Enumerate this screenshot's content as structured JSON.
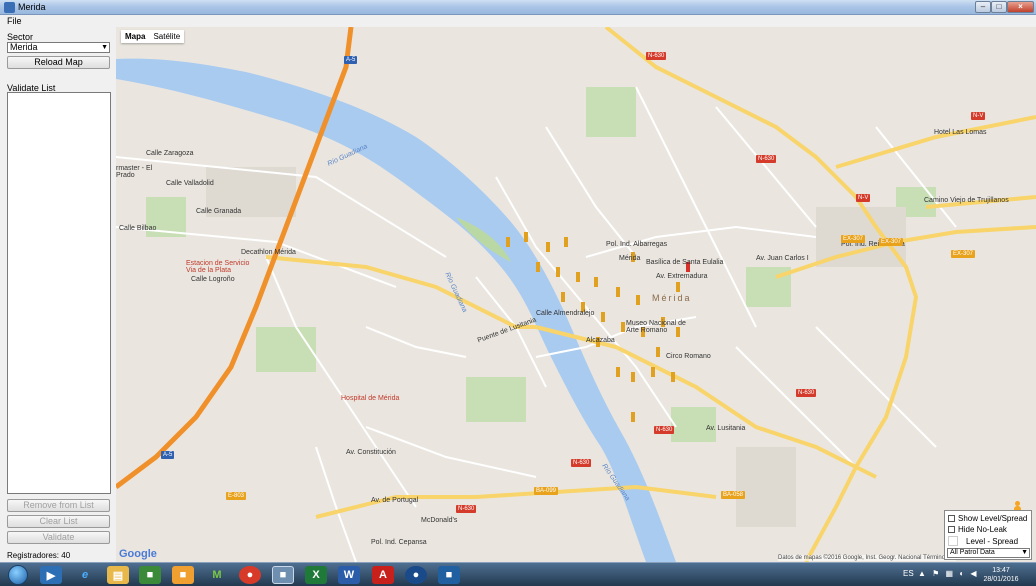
{
  "window": {
    "title": "Merida"
  },
  "menu": {
    "file": "File"
  },
  "left_panel": {
    "sector_label": "Sector",
    "sector_value": "Merida",
    "reload_button": "Reload Map",
    "validate_list_label": "Validate List",
    "remove_button": "Remove from List",
    "clear_button": "Clear List",
    "validate_button": "Validate",
    "registradores": "Registradores: 40"
  },
  "map": {
    "type_mapa": "Mapa",
    "type_satelite": "Satélite",
    "google_logo": "Google",
    "copyright": "Datos de mapas ©2016 Google, Inst. Geogr. Nacional   Términos de",
    "labels": {
      "rio_guadiana_1": "Río Guadiana",
      "rio_guadiana_2": "Río Guadiana",
      "rio_guadiana_3": "Río Guadiana",
      "merida": "Mérida",
      "merida_station": "Mérida",
      "hospital": "Hospital de Mérida",
      "decathlon": "Decathlon Mérida",
      "estacion": "Estacion de Servicio Via de la Plata",
      "poligono_albarregas": "Pol. Ind. Albarregas",
      "poligono_reina": "Pol. Ind. Reina Sofia",
      "hotel": "Hotel Las Lomas",
      "mcdonalds": "McDonald's",
      "cepansa": "Pol. Ind. Cepansa",
      "museo": "Museo Nacional de Arte Romano",
      "alcazaba": "Alcazaba",
      "circo": "Circo Romano",
      "basilica": "Basílica de Santa Eulalia",
      "puente": "Puente de Lusitania",
      "calle_zaragoza": "Calle Zaragoza",
      "calle_valladolid": "Calle Valladolid",
      "calle_granada": "Calle Granada",
      "calle_bilbao": "Calle Bilbao",
      "calle_logrono": "Calle Logroño",
      "av_extremadura": "Av. Extremadura",
      "av_portugal": "Av. de Portugal",
      "camino_trujillanos": "Camino Viejo de Trujillanos",
      "calle_almendralejo": "Calle Almendralejo",
      "av_constitucion": "Av. Constitución",
      "av_lusitania": "Av. Lusitania",
      "av_juan_carlos": "Av. Juan Carlos I",
      "ermasto": "rmaster - El Prado"
    },
    "road_badges": [
      "A-5",
      "N-630",
      "EX-307",
      "EX-307",
      "N-V",
      "BA-099",
      "N-630",
      "A-5",
      "E-803",
      "N-630",
      "EX-307",
      "N-630",
      "N-630",
      "N-V",
      "BA-058",
      "N-630"
    ]
  },
  "legend": {
    "show_level_spread": "Show Level/Spread",
    "hide_no_leak": "Hide No-Leak",
    "level_spread": "Level - Spread",
    "data_select": "All Patrol Data"
  },
  "taskbar": {
    "lang": "ES",
    "time": "13:47",
    "date": "28/01/2016"
  }
}
